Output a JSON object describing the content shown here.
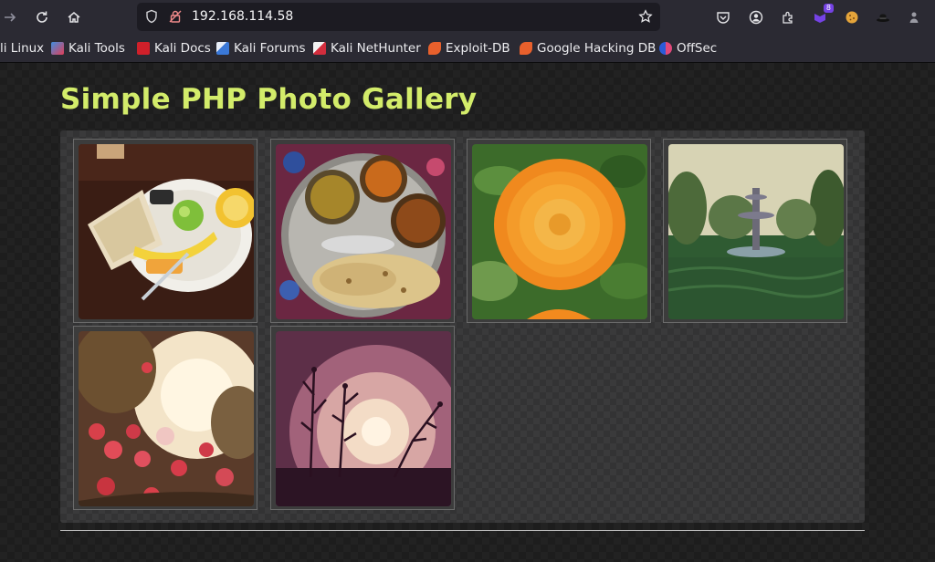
{
  "browser": {
    "url": "192.168.114.58",
    "extension_badge": "8",
    "bookmarks": [
      {
        "label": "li Linux",
        "icon": "kali-icon"
      },
      {
        "label": "Kali Tools",
        "icon": "kali-tools-icon"
      },
      {
        "label": "Kali Docs",
        "icon": "kali-docs-icon"
      },
      {
        "label": "Kali Forums",
        "icon": "kali-forums-icon"
      },
      {
        "label": "Kali NetHunter",
        "icon": "kali-nethunter-icon"
      },
      {
        "label": "Exploit-DB",
        "icon": "exploit-db-icon"
      },
      {
        "label": "Google Hacking DB",
        "icon": "google-hacking-db-icon"
      },
      {
        "label": "OffSec",
        "icon": "offsec-icon"
      }
    ]
  },
  "page": {
    "title": "Simple PHP Photo Gallery",
    "accent_color": "#d3ec6a",
    "photos": [
      {
        "subject": "breakfast plate with toast, banana and juice"
      },
      {
        "subject": "thali plate with curries and roti"
      },
      {
        "subject": "orange marigold flower"
      },
      {
        "subject": "garden fountain"
      },
      {
        "subject": "bougainvillea flowers in sunlight"
      },
      {
        "subject": "plant silhouette against sunset"
      }
    ]
  }
}
